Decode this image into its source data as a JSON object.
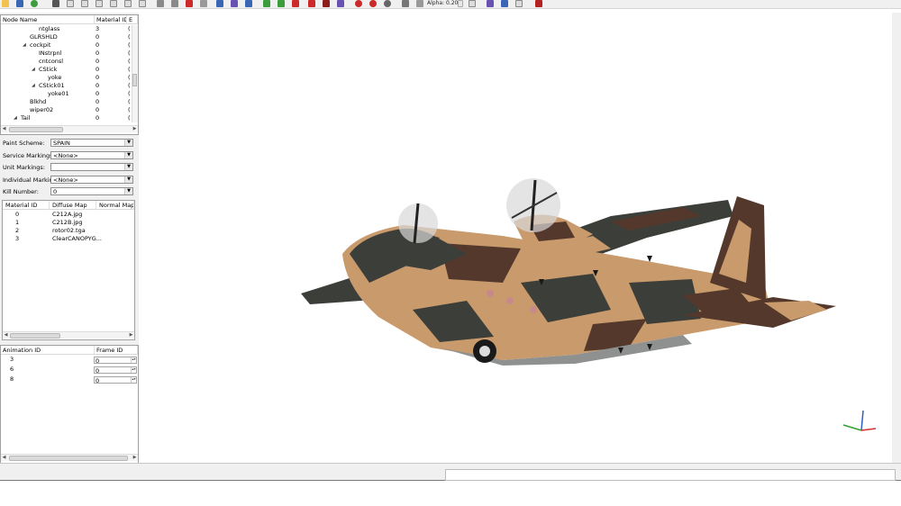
{
  "toolbar": {
    "alpha_label": "Alpha: 0.20",
    "colors": {
      "yellow": "#f2c14e",
      "blue": "#3a67b5",
      "gray": "#8a8a8a",
      "red": "#cc2a2a",
      "green": "#3b9d3b",
      "purple": "#6a52b3",
      "darkred": "#8b1c1c"
    }
  },
  "node_tree": {
    "columns": [
      "Node Name",
      "Material ID",
      "E"
    ],
    "rows": [
      {
        "name": "ntglass",
        "indent": 3,
        "expander": "",
        "material": "3",
        "e": "("
      },
      {
        "name": "GLRSHLD",
        "indent": 2,
        "expander": "",
        "material": "0",
        "e": "("
      },
      {
        "name": "cockpit",
        "indent": 2,
        "expander": "◢",
        "material": "0",
        "e": "("
      },
      {
        "name": "INstrpnl",
        "indent": 3,
        "expander": "",
        "material": "0",
        "e": "("
      },
      {
        "name": "cntconsl",
        "indent": 3,
        "expander": "",
        "material": "0",
        "e": "("
      },
      {
        "name": "CStick",
        "indent": 3,
        "expander": "◢",
        "material": "0",
        "e": "("
      },
      {
        "name": "yoke",
        "indent": 4,
        "expander": "",
        "material": "0",
        "e": "("
      },
      {
        "name": "CStick01",
        "indent": 3,
        "expander": "◢",
        "material": "0",
        "e": "("
      },
      {
        "name": "yoke01",
        "indent": 4,
        "expander": "",
        "material": "0",
        "e": "("
      },
      {
        "name": "Blkhd",
        "indent": 2,
        "expander": "",
        "material": "0",
        "e": "("
      },
      {
        "name": "wiper02",
        "indent": 2,
        "expander": "",
        "material": "0",
        "e": "("
      },
      {
        "name": "Tail",
        "indent": 1,
        "expander": "◢",
        "material": "0",
        "e": "("
      }
    ]
  },
  "markings": {
    "paint_scheme": {
      "label": "Paint Scheme:",
      "value": "SPAIN"
    },
    "service_markings": {
      "label": "Service Markings:",
      "value": "<None>"
    },
    "unit_markings": {
      "label": "Unit Markings:",
      "value": ""
    },
    "individual_markings": {
      "label": "Individual Markings:",
      "value": "<None>"
    },
    "kill_number": {
      "label": "Kill Number:",
      "value": "0"
    }
  },
  "materials": {
    "columns": [
      "Material ID",
      "Diffuse Map",
      "Normal Map"
    ],
    "rows": [
      {
        "id": "0",
        "diffuse": "C212A.jpg",
        "normal": ""
      },
      {
        "id": "1",
        "diffuse": "C212B.jpg",
        "normal": ""
      },
      {
        "id": "2",
        "diffuse": "rotor02.tga",
        "normal": ""
      },
      {
        "id": "3",
        "diffuse": "ClearCANOPYG...",
        "normal": ""
      }
    ]
  },
  "animations": {
    "columns": [
      "Animation ID",
      "Frame ID"
    ],
    "rows": [
      {
        "id": "3",
        "frame": "0"
      },
      {
        "id": "6",
        "frame": "0"
      },
      {
        "id": "8",
        "frame": "0"
      }
    ]
  },
  "viewport": {
    "camo_colors": {
      "tan": "#c89a6c",
      "brown": "#55382c",
      "dark": "#3c3e3a",
      "gray": "#8f9190",
      "under": "#a58866"
    }
  }
}
